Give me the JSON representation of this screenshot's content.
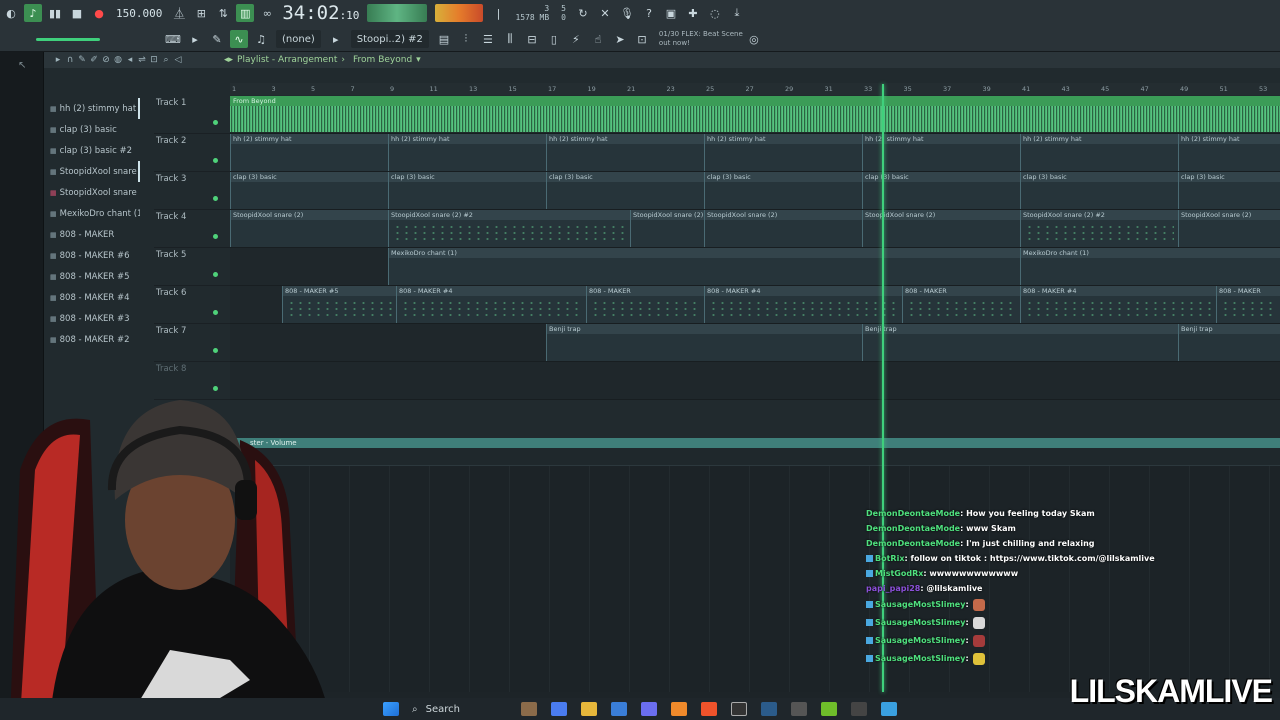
{
  "toolbar": {
    "tempo": "150.000",
    "time_main": "34:02",
    "time_sub": ":10",
    "pattern": "Stoopi..2) #2",
    "channel_selector": "(none)",
    "cpu_top": "3",
    "cpu_mem": "1578 MB",
    "cpu_poly": "5",
    "cpu_zero": "0",
    "news_line1": "01/30  FLEX: Beat Scene",
    "news_line2": "out now!"
  },
  "playlist": {
    "window_title": "Playlist - Arrangement",
    "arrangement_name": "From Beyond",
    "picker_items": [
      {
        "label": "hh (2) stimmy hat",
        "selected": true
      },
      {
        "label": "clap (3) basic"
      },
      {
        "label": "clap (3) basic #2"
      },
      {
        "label": "StoopidXool snare (2",
        "selected": true
      },
      {
        "label": "StoopidXool snare (2) #2",
        "red": true
      },
      {
        "label": "MexikoDro chant (1)"
      },
      {
        "label": "808 - MAKER"
      },
      {
        "label": "808 - MAKER #6"
      },
      {
        "label": "808 - MAKER #5"
      },
      {
        "label": "808 - MAKER #4"
      },
      {
        "label": "808 - MAKER #3"
      },
      {
        "label": "808 - MAKER #2"
      }
    ],
    "ruler": [
      "1",
      "3",
      "5",
      "7",
      "9",
      "11",
      "13",
      "15",
      "17",
      "19",
      "21",
      "23",
      "25",
      "27",
      "29",
      "31",
      "33",
      "35",
      "37",
      "39",
      "41",
      "43",
      "45",
      "47",
      "49",
      "51",
      "53"
    ],
    "tracks": [
      "Track 1",
      "Track 2",
      "Track 3",
      "Track 4",
      "Track 5",
      "Track 6",
      "Track 7",
      "Track 8"
    ],
    "audio_clip_label": "From Beyond",
    "automation_label": "ster - Volume",
    "clip_labels": {
      "hh": "hh (2) stimmy hat",
      "clap": "clap (3) basic",
      "snare": "StoopidXool snare (2)",
      "snare2": "StoopidXool snare (2) #2",
      "chant": "MexikoDro chant (1)",
      "m5": "808 - MAKER #5",
      "m4": "808 - MAKER #4",
      "m": "808 - MAKER",
      "benji": "Benji trap"
    }
  },
  "chat": [
    {
      "user": "DemonDeontaeMode",
      "text": ": How you feeling today Skam"
    },
    {
      "user": "DemonDeontaeMode",
      "text": ": www Skam"
    },
    {
      "user": "DemonDeontaeMode",
      "text": ": I'm just chilling and relaxing"
    },
    {
      "user": "BotRix",
      "text": ": follow on tiktok : https://www.tiktok.com/@lilskamlive"
    },
    {
      "user": "MistGodRx",
      "text": ": wwwwwwwwwwww"
    },
    {
      "user": "papi_papi28",
      "text": ": @lilskamlive"
    },
    {
      "user": "SausageMostSlimey",
      "text": ":"
    },
    {
      "user": "SausageMostSlimey",
      "text": ":"
    },
    {
      "user": "SausageMostSlimey",
      "text": ":"
    },
    {
      "user": "SausageMostSlimey",
      "text": ":"
    }
  ],
  "taskbar": {
    "search_label": "Search"
  },
  "overlay": {
    "brand": "LILSKAMLIVE"
  },
  "colors": {
    "accent": "#3fd07c",
    "toolbar": "#2a3338",
    "chat_user": "#4fe07e"
  }
}
